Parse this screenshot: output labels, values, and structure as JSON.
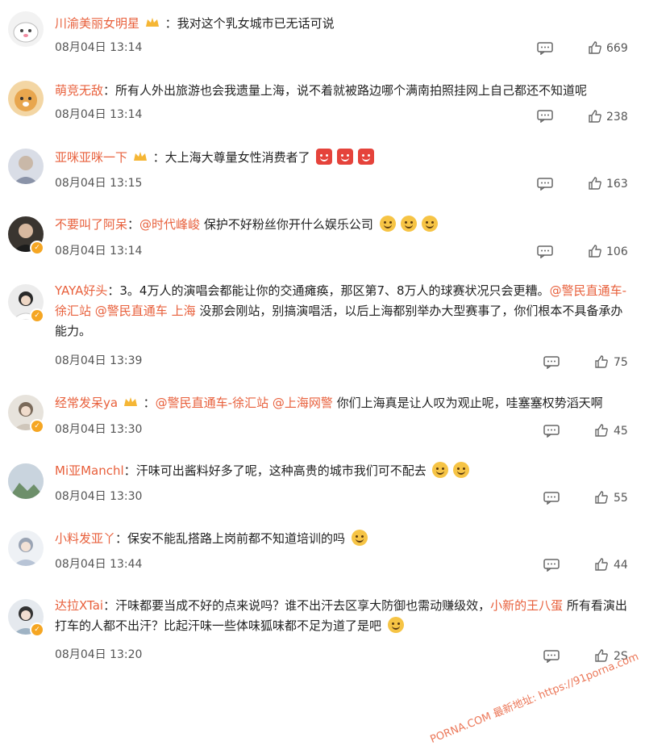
{
  "comments": [
    {
      "user": "川渝美丽女明星",
      "text": "我对这个乳女城市已无话可说",
      "time": "08月04日 13:14",
      "likes": "669"
    },
    {
      "user": "萌竞无敌",
      "text": "所有人外出旅游也会我遗量上海，说不着就被路边哪个满南拍照挂网上自己都还不知道呢",
      "time": "08月04日 13:14",
      "likes": "238"
    },
    {
      "user": "亚咪亚咪一下",
      "text": "大上海大尊量女性消费者了",
      "time": "08月04日 13:15",
      "likes": "163"
    },
    {
      "user": "不要叫了阿呆",
      "mention": "@时代峰峻",
      "text": "保护不好粉丝你开什么娱乐公司",
      "time": "08月04日 13:14",
      "likes": "106"
    },
    {
      "user": "YAYA好头",
      "text_a": "3。4万人的演唱会都能让你的交通瘫痪，那区第7、8万人的球赛状况只会更糟。",
      "mention_1": "@警民直通车-徐汇站",
      "mention_2": "@警民直通车 上海",
      "text_b": "没那会刚站，别搞演唱活，以后上海都别举办大型赛事了，你们根本不具备承办能力。",
      "time": "08月04日 13:39",
      "likes": "75"
    },
    {
      "user": "经常发呆ya",
      "mention_1": "@警民直通车-徐汇站",
      "mention_2": "@上海网警",
      "text": "你们上海真是让人叹为观止呢，哇塞塞权势滔天啊",
      "time": "08月04日 13:30",
      "likes": "45"
    },
    {
      "user": "Mi亚Manchl",
      "text": "汗味可出酱料好多了呢，这种高贵的城市我们可不配去",
      "time": "08月04日 13:30",
      "likes": "55"
    },
    {
      "user": "小料发亚丫",
      "text": "保安不能乱搭路上岗前都不知道培训的吗",
      "time": "08月04日 13:44",
      "likes": "44"
    },
    {
      "user": "达拉XTai",
      "text_a": "汗味都要当成不好的点来说吗？谁不出汗去区享大防御也需动赚级效，",
      "mention": "小新的王八蛋",
      "text_b": "所有看演出打车的人都不出汗？比起汗味一些体味狐味都不足为道了是吧",
      "time": "08月04日 13:20",
      "likes": "2S"
    }
  ],
  "watermark": "PORNA.COM 最新地址: https://91porna.com"
}
